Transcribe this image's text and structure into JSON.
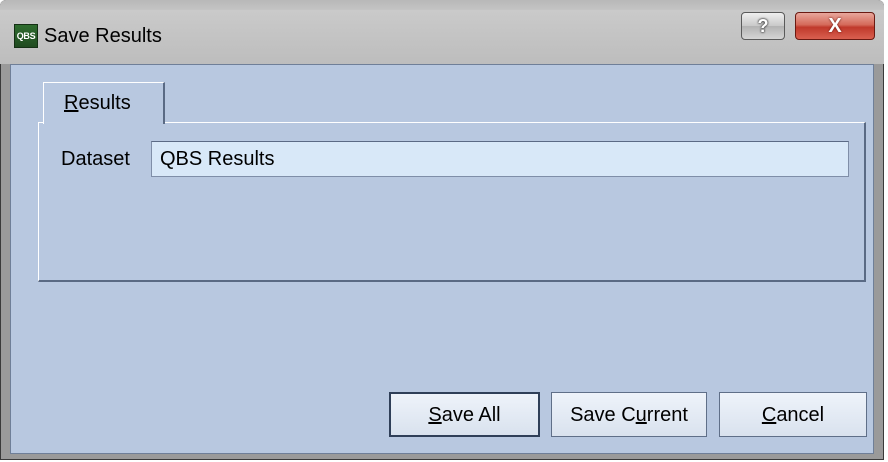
{
  "window": {
    "title": "Save Results",
    "app_icon_text": "QBS",
    "help_button": "?",
    "close_button": "X"
  },
  "tabs": [
    {
      "label": "Results",
      "accelerator": "R"
    }
  ],
  "dataset": {
    "label": "Dataset",
    "value": "QBS Results"
  },
  "buttons": {
    "save_all": "Save All",
    "save_current": "Save Current",
    "cancel": "Cancel"
  },
  "colors": {
    "client_background": "#b8c8e0",
    "input_background": "#d8e8f8",
    "close_button": "#c0392b"
  }
}
